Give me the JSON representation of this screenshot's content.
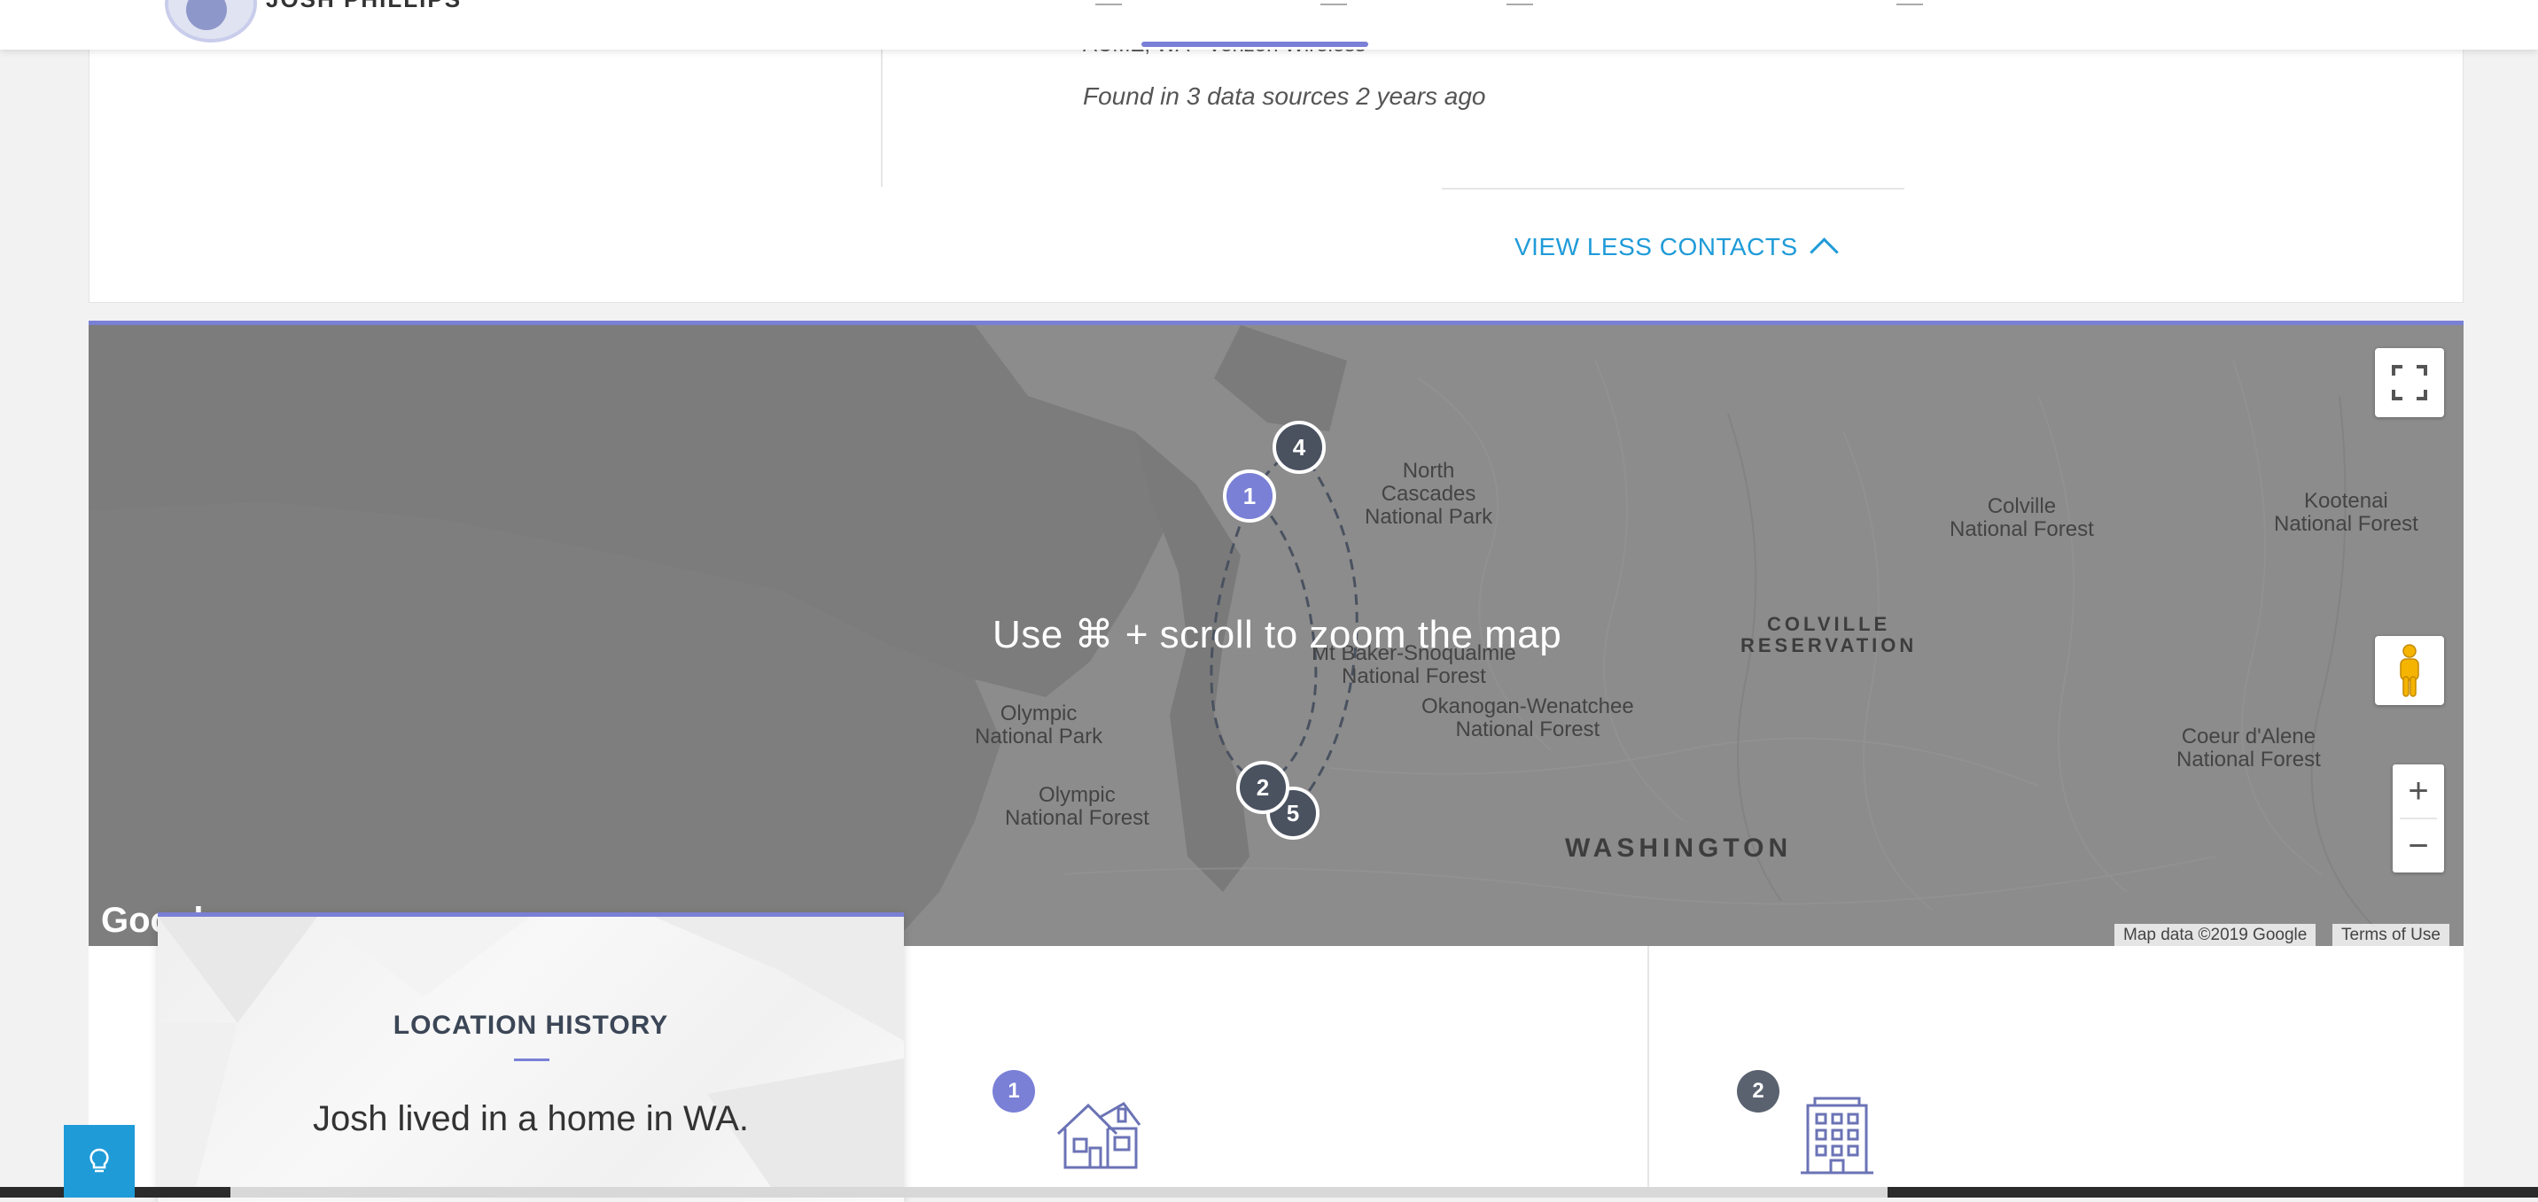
{
  "header": {
    "name": "JOSH PHILLIPS"
  },
  "contacts": {
    "carrier_line": "ACME, WA - Verizon Wireless",
    "found_text": "Found in 3 data sources 2 years ago",
    "view_less_label": "VIEW LESS CONTACTS"
  },
  "map": {
    "hint": "Use ⌘ + scroll to zoom the map",
    "labels": {
      "north_cascades": "North\nCascades\nNational Park",
      "colville_nf": "Colville\nNational Forest",
      "kootenai": "Kootenai\nNational Forest",
      "colville_res": "COLVILLE\nRESERVATION",
      "baker": "Mt Baker-Snoqualmie\nNational Forest",
      "okanogan": "Okanogan-Wenatchee\nNational Forest",
      "coeur": "Coeur d'Alene\nNational Forest",
      "olympic_park": "Olympic\nNational Park",
      "olympic_forest": "Olympic\nNational Forest",
      "washington": "WASHINGTON"
    },
    "markers": [
      "1",
      "2",
      "4",
      "5"
    ],
    "google": "Google",
    "map_data": "Map data ©2019 Google",
    "terms": "Terms of Use",
    "zoom_in": "+",
    "zoom_out": "−"
  },
  "location_history": {
    "title": "LOCATION HISTORY",
    "description": "Josh lived in a home in WA."
  },
  "entries": [
    {
      "badge": "1",
      "icon": "house-icon"
    },
    {
      "badge": "2",
      "icon": "building-icon"
    }
  ],
  "colors": {
    "accent": "#7a80d6",
    "link": "#1f9bd8",
    "marker_dark": "#4a5260"
  }
}
